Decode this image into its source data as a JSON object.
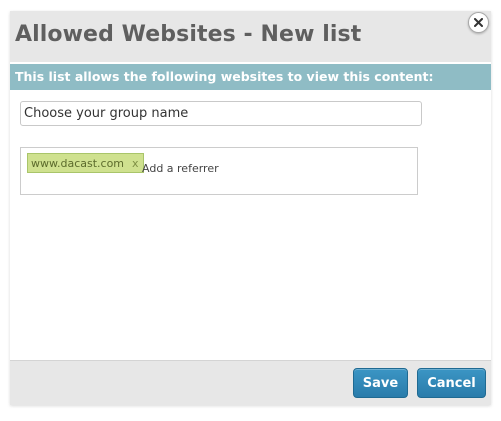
{
  "dialog": {
    "title": "Allowed Websites - New list",
    "close_icon": "close-icon"
  },
  "banner": {
    "text": "This list allows the following websites to view this content:",
    "color": "#8fbcc5"
  },
  "group_name": {
    "value": "",
    "placeholder": "Choose your group name"
  },
  "referrers": {
    "tags": [
      {
        "label": "www.dacast.com",
        "remove_glyph": "x"
      }
    ],
    "input_value": "",
    "input_placeholder": "Add a referrer",
    "tag_color": "#cfe18f"
  },
  "footer": {
    "save_label": "Save",
    "cancel_label": "Cancel",
    "button_color": "#2a7cab"
  }
}
